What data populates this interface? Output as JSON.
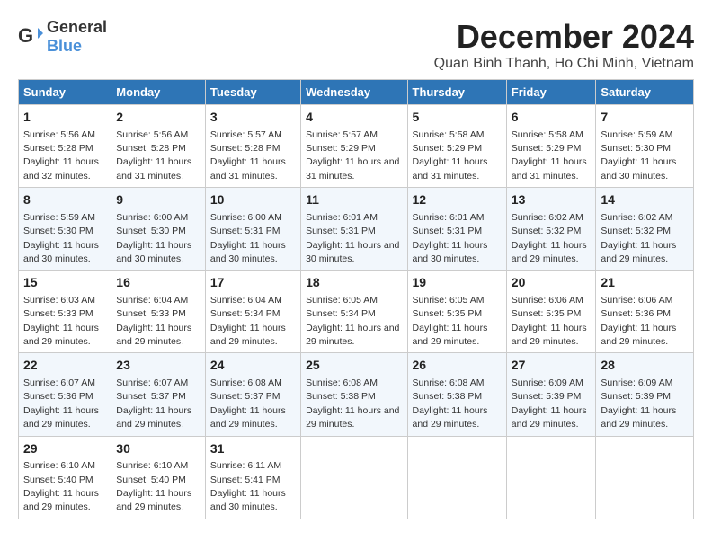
{
  "logo": {
    "text_general": "General",
    "text_blue": "Blue"
  },
  "header": {
    "title": "December 2024",
    "subtitle": "Quan Binh Thanh, Ho Chi Minh, Vietnam"
  },
  "weekdays": [
    "Sunday",
    "Monday",
    "Tuesday",
    "Wednesday",
    "Thursday",
    "Friday",
    "Saturday"
  ],
  "weeks": [
    [
      {
        "day": "1",
        "sunrise": "5:56 AM",
        "sunset": "5:28 PM",
        "daylight": "11 hours and 32 minutes."
      },
      {
        "day": "2",
        "sunrise": "5:56 AM",
        "sunset": "5:28 PM",
        "daylight": "11 hours and 31 minutes."
      },
      {
        "day": "3",
        "sunrise": "5:57 AM",
        "sunset": "5:28 PM",
        "daylight": "11 hours and 31 minutes."
      },
      {
        "day": "4",
        "sunrise": "5:57 AM",
        "sunset": "5:29 PM",
        "daylight": "11 hours and 31 minutes."
      },
      {
        "day": "5",
        "sunrise": "5:58 AM",
        "sunset": "5:29 PM",
        "daylight": "11 hours and 31 minutes."
      },
      {
        "day": "6",
        "sunrise": "5:58 AM",
        "sunset": "5:29 PM",
        "daylight": "11 hours and 31 minutes."
      },
      {
        "day": "7",
        "sunrise": "5:59 AM",
        "sunset": "5:30 PM",
        "daylight": "11 hours and 30 minutes."
      }
    ],
    [
      {
        "day": "8",
        "sunrise": "5:59 AM",
        "sunset": "5:30 PM",
        "daylight": "11 hours and 30 minutes."
      },
      {
        "day": "9",
        "sunrise": "6:00 AM",
        "sunset": "5:30 PM",
        "daylight": "11 hours and 30 minutes."
      },
      {
        "day": "10",
        "sunrise": "6:00 AM",
        "sunset": "5:31 PM",
        "daylight": "11 hours and 30 minutes."
      },
      {
        "day": "11",
        "sunrise": "6:01 AM",
        "sunset": "5:31 PM",
        "daylight": "11 hours and 30 minutes."
      },
      {
        "day": "12",
        "sunrise": "6:01 AM",
        "sunset": "5:31 PM",
        "daylight": "11 hours and 30 minutes."
      },
      {
        "day": "13",
        "sunrise": "6:02 AM",
        "sunset": "5:32 PM",
        "daylight": "11 hours and 29 minutes."
      },
      {
        "day": "14",
        "sunrise": "6:02 AM",
        "sunset": "5:32 PM",
        "daylight": "11 hours and 29 minutes."
      }
    ],
    [
      {
        "day": "15",
        "sunrise": "6:03 AM",
        "sunset": "5:33 PM",
        "daylight": "11 hours and 29 minutes."
      },
      {
        "day": "16",
        "sunrise": "6:04 AM",
        "sunset": "5:33 PM",
        "daylight": "11 hours and 29 minutes."
      },
      {
        "day": "17",
        "sunrise": "6:04 AM",
        "sunset": "5:34 PM",
        "daylight": "11 hours and 29 minutes."
      },
      {
        "day": "18",
        "sunrise": "6:05 AM",
        "sunset": "5:34 PM",
        "daylight": "11 hours and 29 minutes."
      },
      {
        "day": "19",
        "sunrise": "6:05 AM",
        "sunset": "5:35 PM",
        "daylight": "11 hours and 29 minutes."
      },
      {
        "day": "20",
        "sunrise": "6:06 AM",
        "sunset": "5:35 PM",
        "daylight": "11 hours and 29 minutes."
      },
      {
        "day": "21",
        "sunrise": "6:06 AM",
        "sunset": "5:36 PM",
        "daylight": "11 hours and 29 minutes."
      }
    ],
    [
      {
        "day": "22",
        "sunrise": "6:07 AM",
        "sunset": "5:36 PM",
        "daylight": "11 hours and 29 minutes."
      },
      {
        "day": "23",
        "sunrise": "6:07 AM",
        "sunset": "5:37 PM",
        "daylight": "11 hours and 29 minutes."
      },
      {
        "day": "24",
        "sunrise": "6:08 AM",
        "sunset": "5:37 PM",
        "daylight": "11 hours and 29 minutes."
      },
      {
        "day": "25",
        "sunrise": "6:08 AM",
        "sunset": "5:38 PM",
        "daylight": "11 hours and 29 minutes."
      },
      {
        "day": "26",
        "sunrise": "6:08 AM",
        "sunset": "5:38 PM",
        "daylight": "11 hours and 29 minutes."
      },
      {
        "day": "27",
        "sunrise": "6:09 AM",
        "sunset": "5:39 PM",
        "daylight": "11 hours and 29 minutes."
      },
      {
        "day": "28",
        "sunrise": "6:09 AM",
        "sunset": "5:39 PM",
        "daylight": "11 hours and 29 minutes."
      }
    ],
    [
      {
        "day": "29",
        "sunrise": "6:10 AM",
        "sunset": "5:40 PM",
        "daylight": "11 hours and 29 minutes."
      },
      {
        "day": "30",
        "sunrise": "6:10 AM",
        "sunset": "5:40 PM",
        "daylight": "11 hours and 29 minutes."
      },
      {
        "day": "31",
        "sunrise": "6:11 AM",
        "sunset": "5:41 PM",
        "daylight": "11 hours and 30 minutes."
      },
      null,
      null,
      null,
      null
    ]
  ],
  "labels": {
    "sunrise_prefix": "Sunrise: ",
    "sunset_prefix": "Sunset: ",
    "daylight_prefix": "Daylight: "
  }
}
